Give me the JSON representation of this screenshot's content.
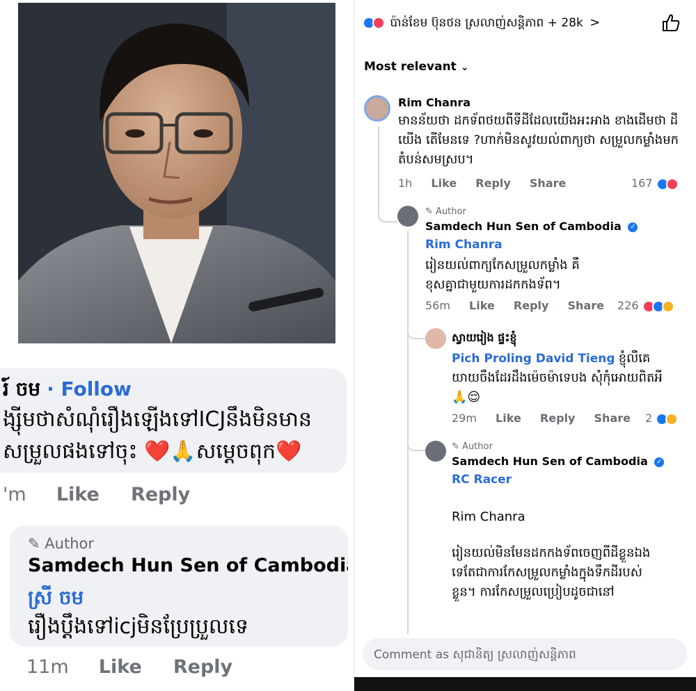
{
  "top_bar": {
    "reactors_text": "ប៉ាន់ខែម ប៊ុនថន ស្រលាញ់សន្តិភាព + 28k",
    "chevron": ">",
    "like_icon": "thumbs-up-outline-icon"
  },
  "sort": {
    "label": "Most relevant",
    "chevron": "⌄"
  },
  "comments": [
    {
      "name": "Rim Chanra",
      "text": "មានន័យថា ដកទ័ពថយពីទីដីដែលយើងអះអាង ខាងដើមថា ដីយើង តើមែនទេ ?ហាក់មិនសូវយល់ពាក្យថា សម្រួលកម្លាំងមកតំបន់សមស្រប។",
      "time": "1h",
      "like": "Like",
      "reply": "Reply",
      "share": "Share",
      "count": "167"
    },
    {
      "author_badge": "Author",
      "name": "Samdech Hun Sen of Cambodia",
      "mention": "Rim Chanra",
      "text": "រៀនយល់ពាក្យកែសម្រួលកម្លាំង គឺខុសគ្នាជាមួយការដកកងទ័ព។",
      "time": "56m",
      "like": "Like",
      "reply": "Reply",
      "share": "Share",
      "count": "226"
    },
    {
      "name": "ស្វាយរៀង ផ្ទះខ្ញុំ",
      "mention": "Pich Proling David Tieng",
      "text_inline": "ខ្ញុំលឺគេ",
      "text": "យាយចឹងដែរដឹងម៉េចម៉ាទេបង សុំកុំអោយពិតអី🙏😌",
      "time": "29m",
      "like": "Like",
      "reply": "Reply",
      "share": "Share",
      "count": "2"
    },
    {
      "author_badge": "Author",
      "name": "Samdech Hun Sen of Cambodia",
      "mention": "RC Racer",
      "text_a": "Rim Chanra",
      "text_b": "រៀនយល់មិនមែនដកកងទ័ពចេញពីដីខ្លួនឯងទេតែជាការកែសម្រួលកម្លាំងក្នុងទឹកដីរបស់ខ្លួន។ ការកែសម្រួលប្រៀបដូចជានៅ"
    }
  ],
  "comment_box": {
    "placeholder": "Comment as សុជានិត្យ ស្រលាញ់សន្តិភាព"
  },
  "left_panel": {
    "name_partial": "រ៍ ចម",
    "follow": "· Follow",
    "line1": "ង្ស៊ីមថាសំណុំរឿងឡើងទៅICJនឹងមិនមាន",
    "line2": "សម្រួលផងទៅចុះ ❤️🙏សម្តេចពុក❤️",
    "time": "'m",
    "like": "Like",
    "reply": "Reply",
    "author_badge": "Author",
    "author_name": "Samdech Hun Sen of Cambodia",
    "mention": "ស្រី ចម",
    "reply_text": "រឿងប្តឹងទៅicjមិនប្រែប្រួលទេ",
    "reply_time": "11m",
    "reply_like": "Like",
    "reply_reply": "Reply"
  }
}
